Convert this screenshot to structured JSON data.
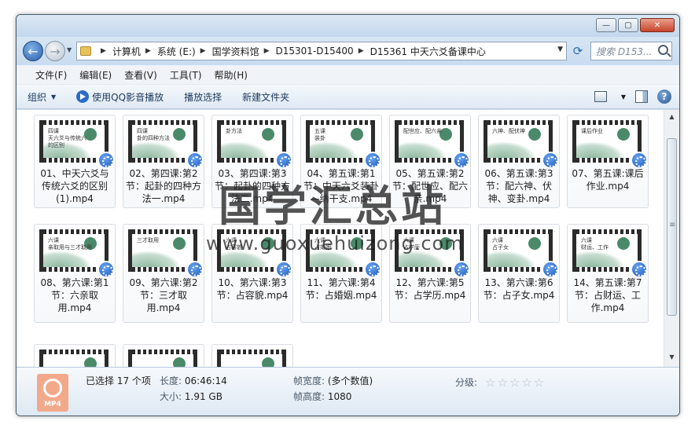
{
  "window": {
    "buttons": {
      "minimize": "—",
      "maximize": "▢",
      "close": "✕"
    }
  },
  "address": {
    "breadcrumbs": [
      "计算机",
      "系统 (E:)",
      "国学资料馆",
      "D15301-D15400",
      "D15361 中天六爻备课中心"
    ],
    "search_placeholder": "搜索 D153..."
  },
  "menu": [
    "文件(F)",
    "编辑(E)",
    "查看(V)",
    "工具(T)",
    "帮助(H)"
  ],
  "toolbar": {
    "organize": "组织",
    "play_qq": "使用QQ影音播放",
    "play_selection": "播放选择",
    "new_folder": "新建文件夹"
  },
  "files": [
    {
      "name": "01、中天六爻与传统六爻的区别(1).mp4",
      "thumb": "四课\n天六爻与传统六\n的区别"
    },
    {
      "name": "02、第四课:第2节：起卦的四种方法一.mp4",
      "thumb": "四课\n卦的四种方法"
    },
    {
      "name": "03、第四课:第3节：起卦的四种方法二.mp4",
      "thumb": "卦方法"
    },
    {
      "name": "04、第五课:第1节：中天六爻装卦—纳干支.mp4",
      "thumb": "五课\n装卦"
    },
    {
      "name": "05、第五课:第2节：配世应、配六亲.mp4",
      "thumb": "配世应、配六亲"
    },
    {
      "name": "06、第五课:第3节：配六神、伏神、变卦.mp4",
      "thumb": "六神、配伏神"
    },
    {
      "name": "07、第五课:课后作业.mp4",
      "thumb": "课后作业"
    },
    {
      "name": "08、第六课:第1节：六亲取用.mp4",
      "thumb": "六课\n亲取用与三才取用"
    },
    {
      "name": "09、第六课:第2节：三才取用.mp4",
      "thumb": "三才取用"
    },
    {
      "name": "10、第六课:第3节：占容貌.mp4",
      "thumb": "六课\n占容貌"
    },
    {
      "name": "11、第六课:第4节：占婚姻.mp4",
      "thumb": "六课\n占婚姻"
    },
    {
      "name": "12、第六课:第5节：占学历.mp4",
      "thumb": "六课\n占学历"
    },
    {
      "name": "13、第六课:第6节：占子女.mp4",
      "thumb": "六课\n占子女"
    },
    {
      "name": "14、第五课:第7节：占财运、工作.mp4",
      "thumb": "六课\n财运、工作"
    },
    {
      "name": "",
      "thumb": ""
    },
    {
      "name": "",
      "thumb": ""
    },
    {
      "name": "",
      "thumb": ""
    }
  ],
  "watermark": {
    "title": "国学汇总站",
    "url": "www.guoxuehuizong.com"
  },
  "status": {
    "selected": "已选择 17 个项",
    "length_label": "长度:",
    "length": "06:46:14",
    "size_label": "大小:",
    "size": "1.91 GB",
    "frame_width_label": "帧宽度:",
    "frame_width": "(多个数值)",
    "frame_height_label": "帧高度:",
    "frame_height": "1080",
    "rating_label": "分级:",
    "rating_stars": 0,
    "file_type": "MP4"
  }
}
